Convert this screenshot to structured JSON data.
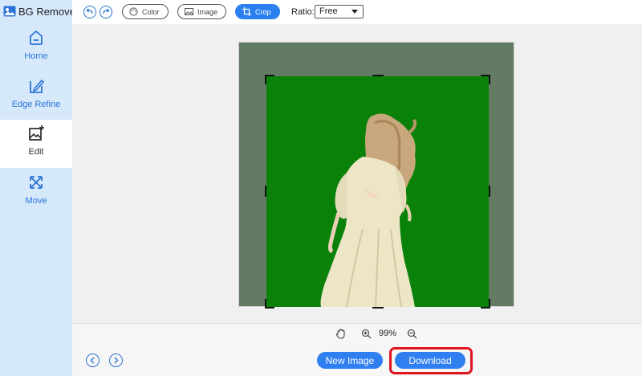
{
  "app": {
    "title": "BG Remover"
  },
  "sidebar": {
    "items": [
      {
        "label": "Home",
        "icon": "home-icon",
        "active": false
      },
      {
        "label": "Edge Refine",
        "icon": "edge-refine-icon",
        "active": false
      },
      {
        "label": "Edit",
        "icon": "edit-image-icon",
        "active": true
      },
      {
        "label": "Move",
        "icon": "move-icon",
        "active": false
      }
    ]
  },
  "toolbar": {
    "color_label": "Color",
    "image_label": "Image",
    "crop_label": "Crop",
    "ratio_label": "Ratio:",
    "ratio_value": "Free"
  },
  "zoom": {
    "value": "99%"
  },
  "footer": {
    "new_image_label": "New Image",
    "download_label": "Download"
  },
  "colors": {
    "accent": "#2f7ff0",
    "sidebar_bg": "#d6e9fb",
    "background_green": "#0a8209",
    "highlight": "#e0141e"
  }
}
